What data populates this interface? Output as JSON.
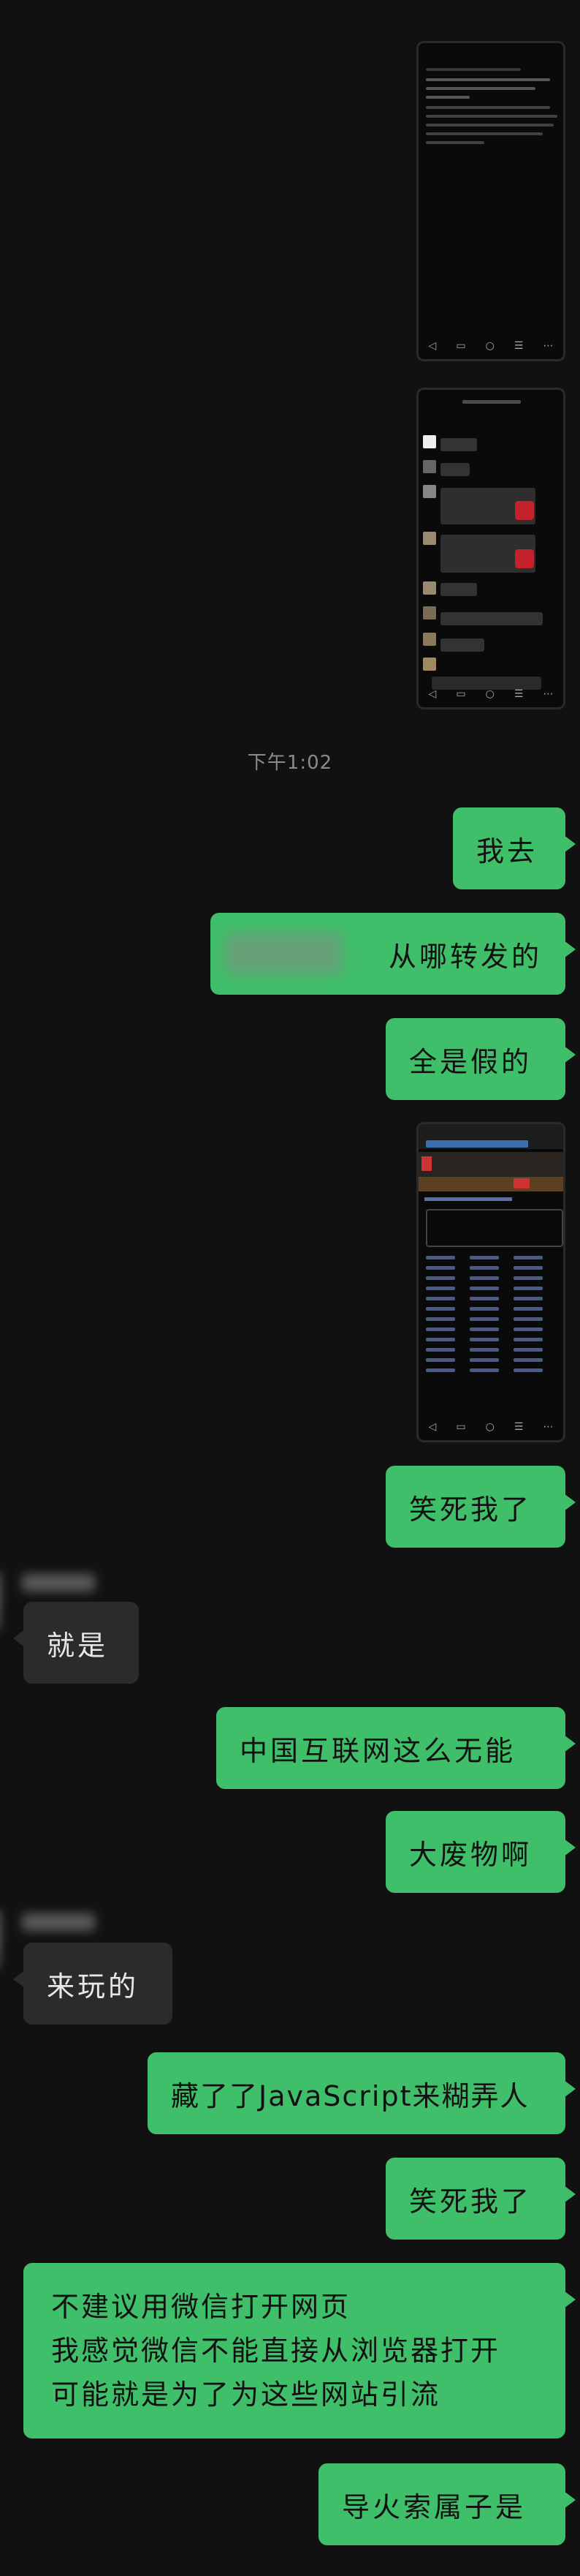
{
  "timestamps": {
    "t1": "下午1:02"
  },
  "messages": {
    "m1": "我去",
    "m2": "从哪转发的",
    "m3": "全是假的",
    "m4": "笑死我了",
    "m5": "就是",
    "m6": "中国互联网这么无能",
    "m7": "大废物啊",
    "m8": "来玩的",
    "m9": "藏了了JavaScript来糊弄人",
    "m10": "笑死我了",
    "m11": [
      "不建议用微信打开网页",
      "我感觉微信不能直接从浏览器打开",
      "可能就是为了为这些网站引流"
    ],
    "m12": "导火索属子是"
  },
  "colors": {
    "background": "#111111",
    "my_bubble": "#3fbf69",
    "other_bubble": "#2b2b2b"
  },
  "icons": {
    "image_thumbnails": "screenshot-image"
  }
}
